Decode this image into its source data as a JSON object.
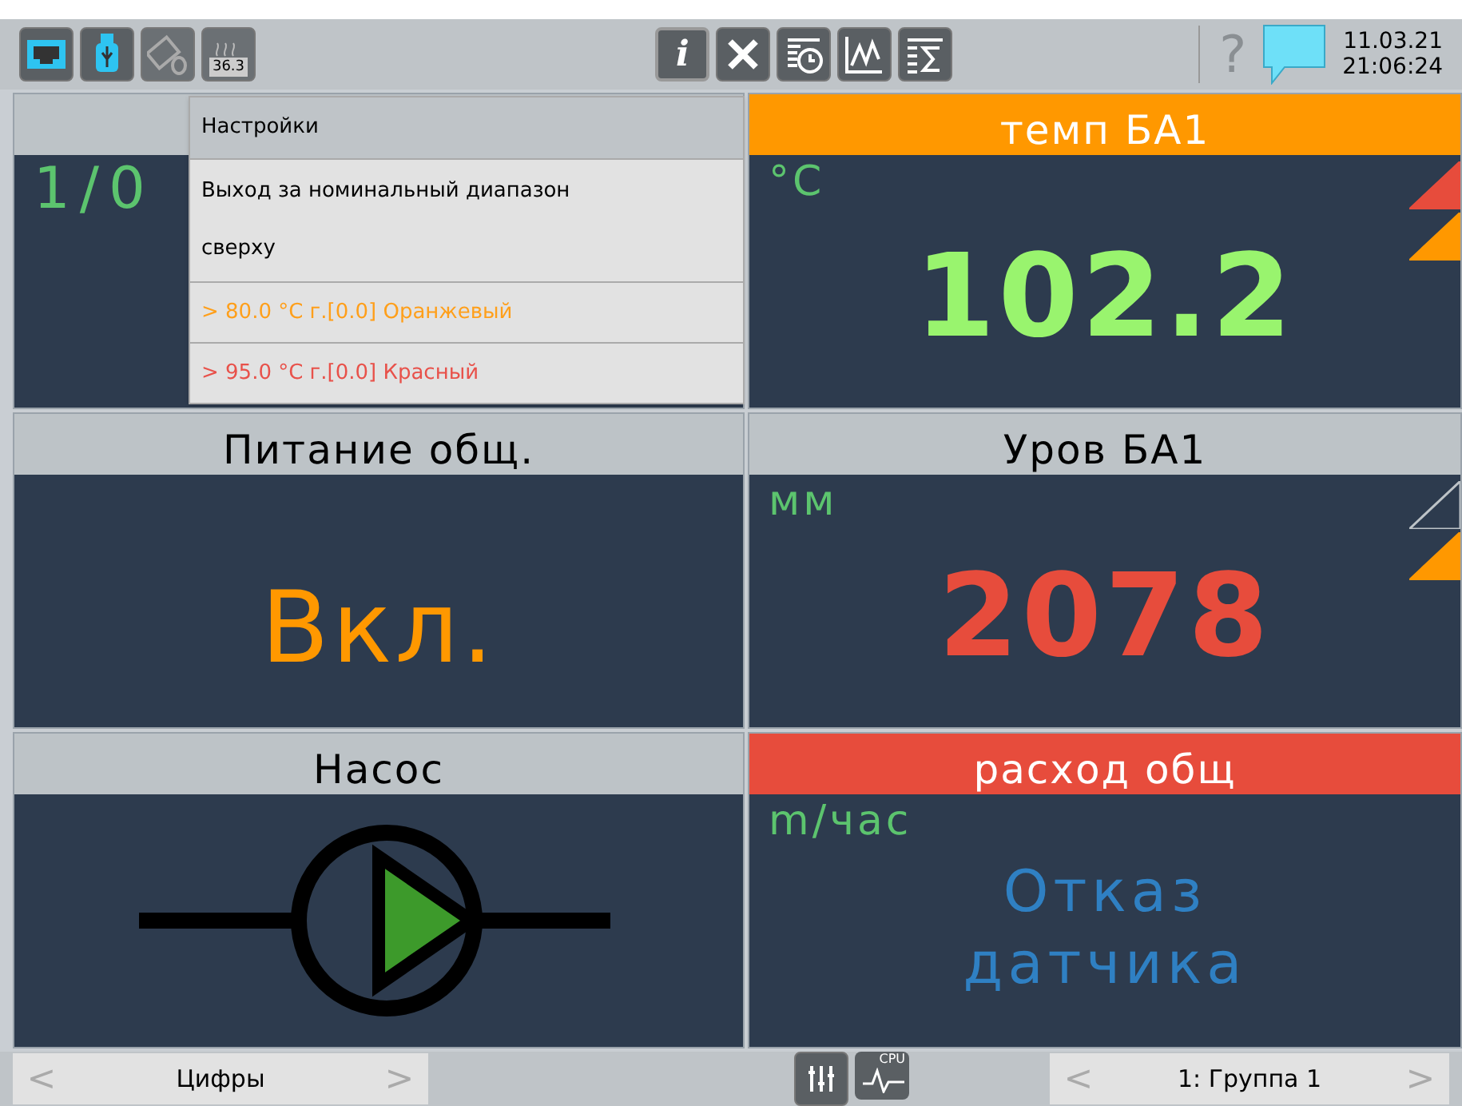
{
  "top_bar": {
    "temperature": "36.3",
    "info": "i",
    "help": "?",
    "date": "11.03.21",
    "time": "21:06:24"
  },
  "tiles": [
    {
      "kind": "text",
      "header": {
        "color": "#bdc3c7"
      },
      "unit": "1/0"
    },
    {
      "kind": "value",
      "header": {
        "title": "темп БА1",
        "color": "#ff9800"
      },
      "unit": "°C",
      "value": "102.2",
      "color": "#99f46e",
      "alarms": [
        {
          "active": true,
          "color": "#e74c3c"
        },
        {
          "active": true,
          "color": "#ff9800"
        }
      ]
    },
    {
      "kind": "state",
      "header": {
        "title": "Питание общ.",
        "color": "#bdc3c7"
      },
      "value": "Вкл.",
      "color": "#ff9800"
    },
    {
      "kind": "value",
      "header": {
        "title": "Уров БА1",
        "color": "#bdc3c7"
      },
      "unit": "мм",
      "value": "2078",
      "color": "#e74c3c",
      "alarms": [
        {
          "active": false
        },
        {
          "active": true,
          "color": "#ff9800"
        }
      ]
    },
    {
      "kind": "pump",
      "header": {
        "title": "Насос",
        "color": "#bdc3c7"
      },
      "running": true
    },
    {
      "kind": "fault",
      "header": {
        "title": "расход общ",
        "color": "#e74c3c"
      },
      "unit": "m/час",
      "value": "Отказ датчика",
      "color": "#2f80c3"
    }
  ],
  "menu": {
    "title": "Настройки",
    "description": "Выход за номинальный диапазон сверху",
    "items": [
      {
        "text": "> 80.0 °C г.[0.0] Оранжевый",
        "color": "#ff9f1a"
      },
      {
        "text": "> 95.0 °C г.[0.0] Красный",
        "color": "#e8514a"
      }
    ]
  },
  "bottom_bar": {
    "left": {
      "prev": "<",
      "label": "Цифры",
      "next": ">"
    },
    "cpu": "CPU",
    "right": {
      "prev": "<",
      "label": "1: Группа 1",
      "next": ">"
    }
  }
}
